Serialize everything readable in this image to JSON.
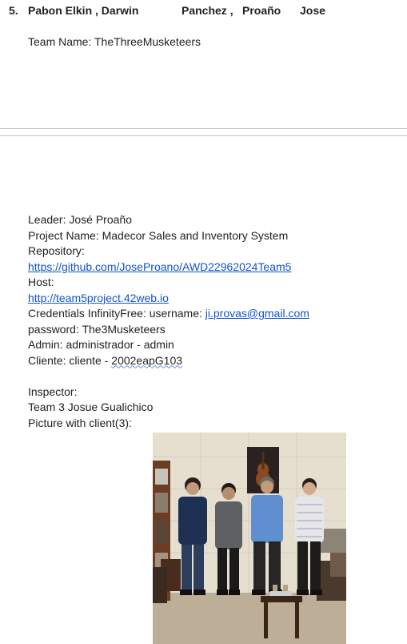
{
  "header": {
    "number": "5.",
    "name1": "Pabon Elkin , Darwin",
    "name2": "Panchez ,",
    "name3": "Proaño",
    "name4": "Jose"
  },
  "team_line": "Team Name: TheThreeMusketeers",
  "details": {
    "leader": "Leader: José Proaño",
    "project": "Project Name: Madecor Sales and Inventory System",
    "repo_label": "Repository:",
    "repo_url": "https://github.com/JoseProano/AWD22962024Team5",
    "host_label": "Host:",
    "host_url": "http://team5project.42web.io",
    "cred_prefix": "Credentials InfinityFree: username: ",
    "cred_email": "ji.provas@gmail.com",
    "password": "password: The3Musketeers",
    "admin": "Admin: administrador - admin",
    "client_prefix": "Cliente: cliente - ",
    "client_pass": "2002eapG103",
    "inspector_label": "Inspector:",
    "inspector": "Team 3 Josue Gualichico",
    "picture_label": "Picture with client(3):"
  },
  "photo": {
    "subject": "group photo of four men standing in an office with a guitar picture on the wall",
    "wall_color": "#e4dccb",
    "floor_color": "#b9ab95"
  }
}
